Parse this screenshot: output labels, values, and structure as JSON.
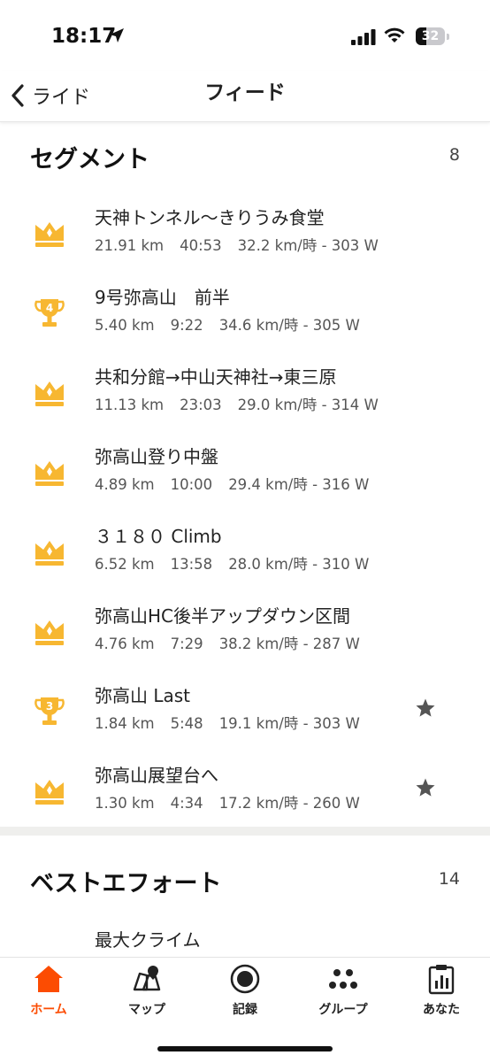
{
  "status_bar": {
    "time": "18:17",
    "battery": "32"
  },
  "nav": {
    "back_label": "ライド",
    "title": "フィード"
  },
  "segments_section": {
    "title": "セグメント",
    "count": "8",
    "items": [
      {
        "icon": "crown-icon",
        "name": "天神トンネル〜きりうみ食堂",
        "distance": "21.91 km",
        "time": "40:53",
        "speed_power": "32.2 km/時 - 303 W",
        "starred": false
      },
      {
        "icon": "trophy-icon",
        "rank": "4",
        "name": "9号弥高山　前半",
        "distance": "5.40 km",
        "time": "9:22",
        "speed_power": "34.6 km/時 - 305 W",
        "starred": false
      },
      {
        "icon": "crown-icon",
        "name": "共和分館→中山天神社→東三原",
        "distance": "11.13 km",
        "time": "23:03",
        "speed_power": "29.0 km/時 - 314 W",
        "starred": false
      },
      {
        "icon": "crown-icon",
        "name": "弥高山登り中盤",
        "distance": "4.89 km",
        "time": "10:00",
        "speed_power": "29.4 km/時 - 316 W",
        "starred": false
      },
      {
        "icon": "crown-icon",
        "name": "３１８０ Climb",
        "distance": "6.52 km",
        "time": "13:58",
        "speed_power": "28.0 km/時 - 310 W",
        "starred": false
      },
      {
        "icon": "crown-icon",
        "name": "弥高山HC後半アップダウン区間",
        "distance": "4.76 km",
        "time": "7:29",
        "speed_power": "38.2 km/時 - 287 W",
        "starred": false
      },
      {
        "icon": "trophy-icon",
        "rank": "3",
        "name": "弥高山 Last",
        "distance": "1.84 km",
        "time": "5:48",
        "speed_power": "19.1 km/時 - 303 W",
        "starred": true
      },
      {
        "icon": "crown-icon",
        "name": "弥高山展望台へ",
        "distance": "1.30 km",
        "time": "4:34",
        "speed_power": "17.2 km/時 - 260 W",
        "starred": true
      }
    ]
  },
  "best_efforts_section": {
    "title": "ベストエフォート",
    "count": "14",
    "first_item": "最大クライム"
  },
  "tab_bar": {
    "home": "ホーム",
    "map": "マップ",
    "record": "記録",
    "groups": "グループ",
    "you": "あなた"
  },
  "colors": {
    "accent": "#fc4c02",
    "gold": "#f7b731",
    "star": "#555555"
  }
}
